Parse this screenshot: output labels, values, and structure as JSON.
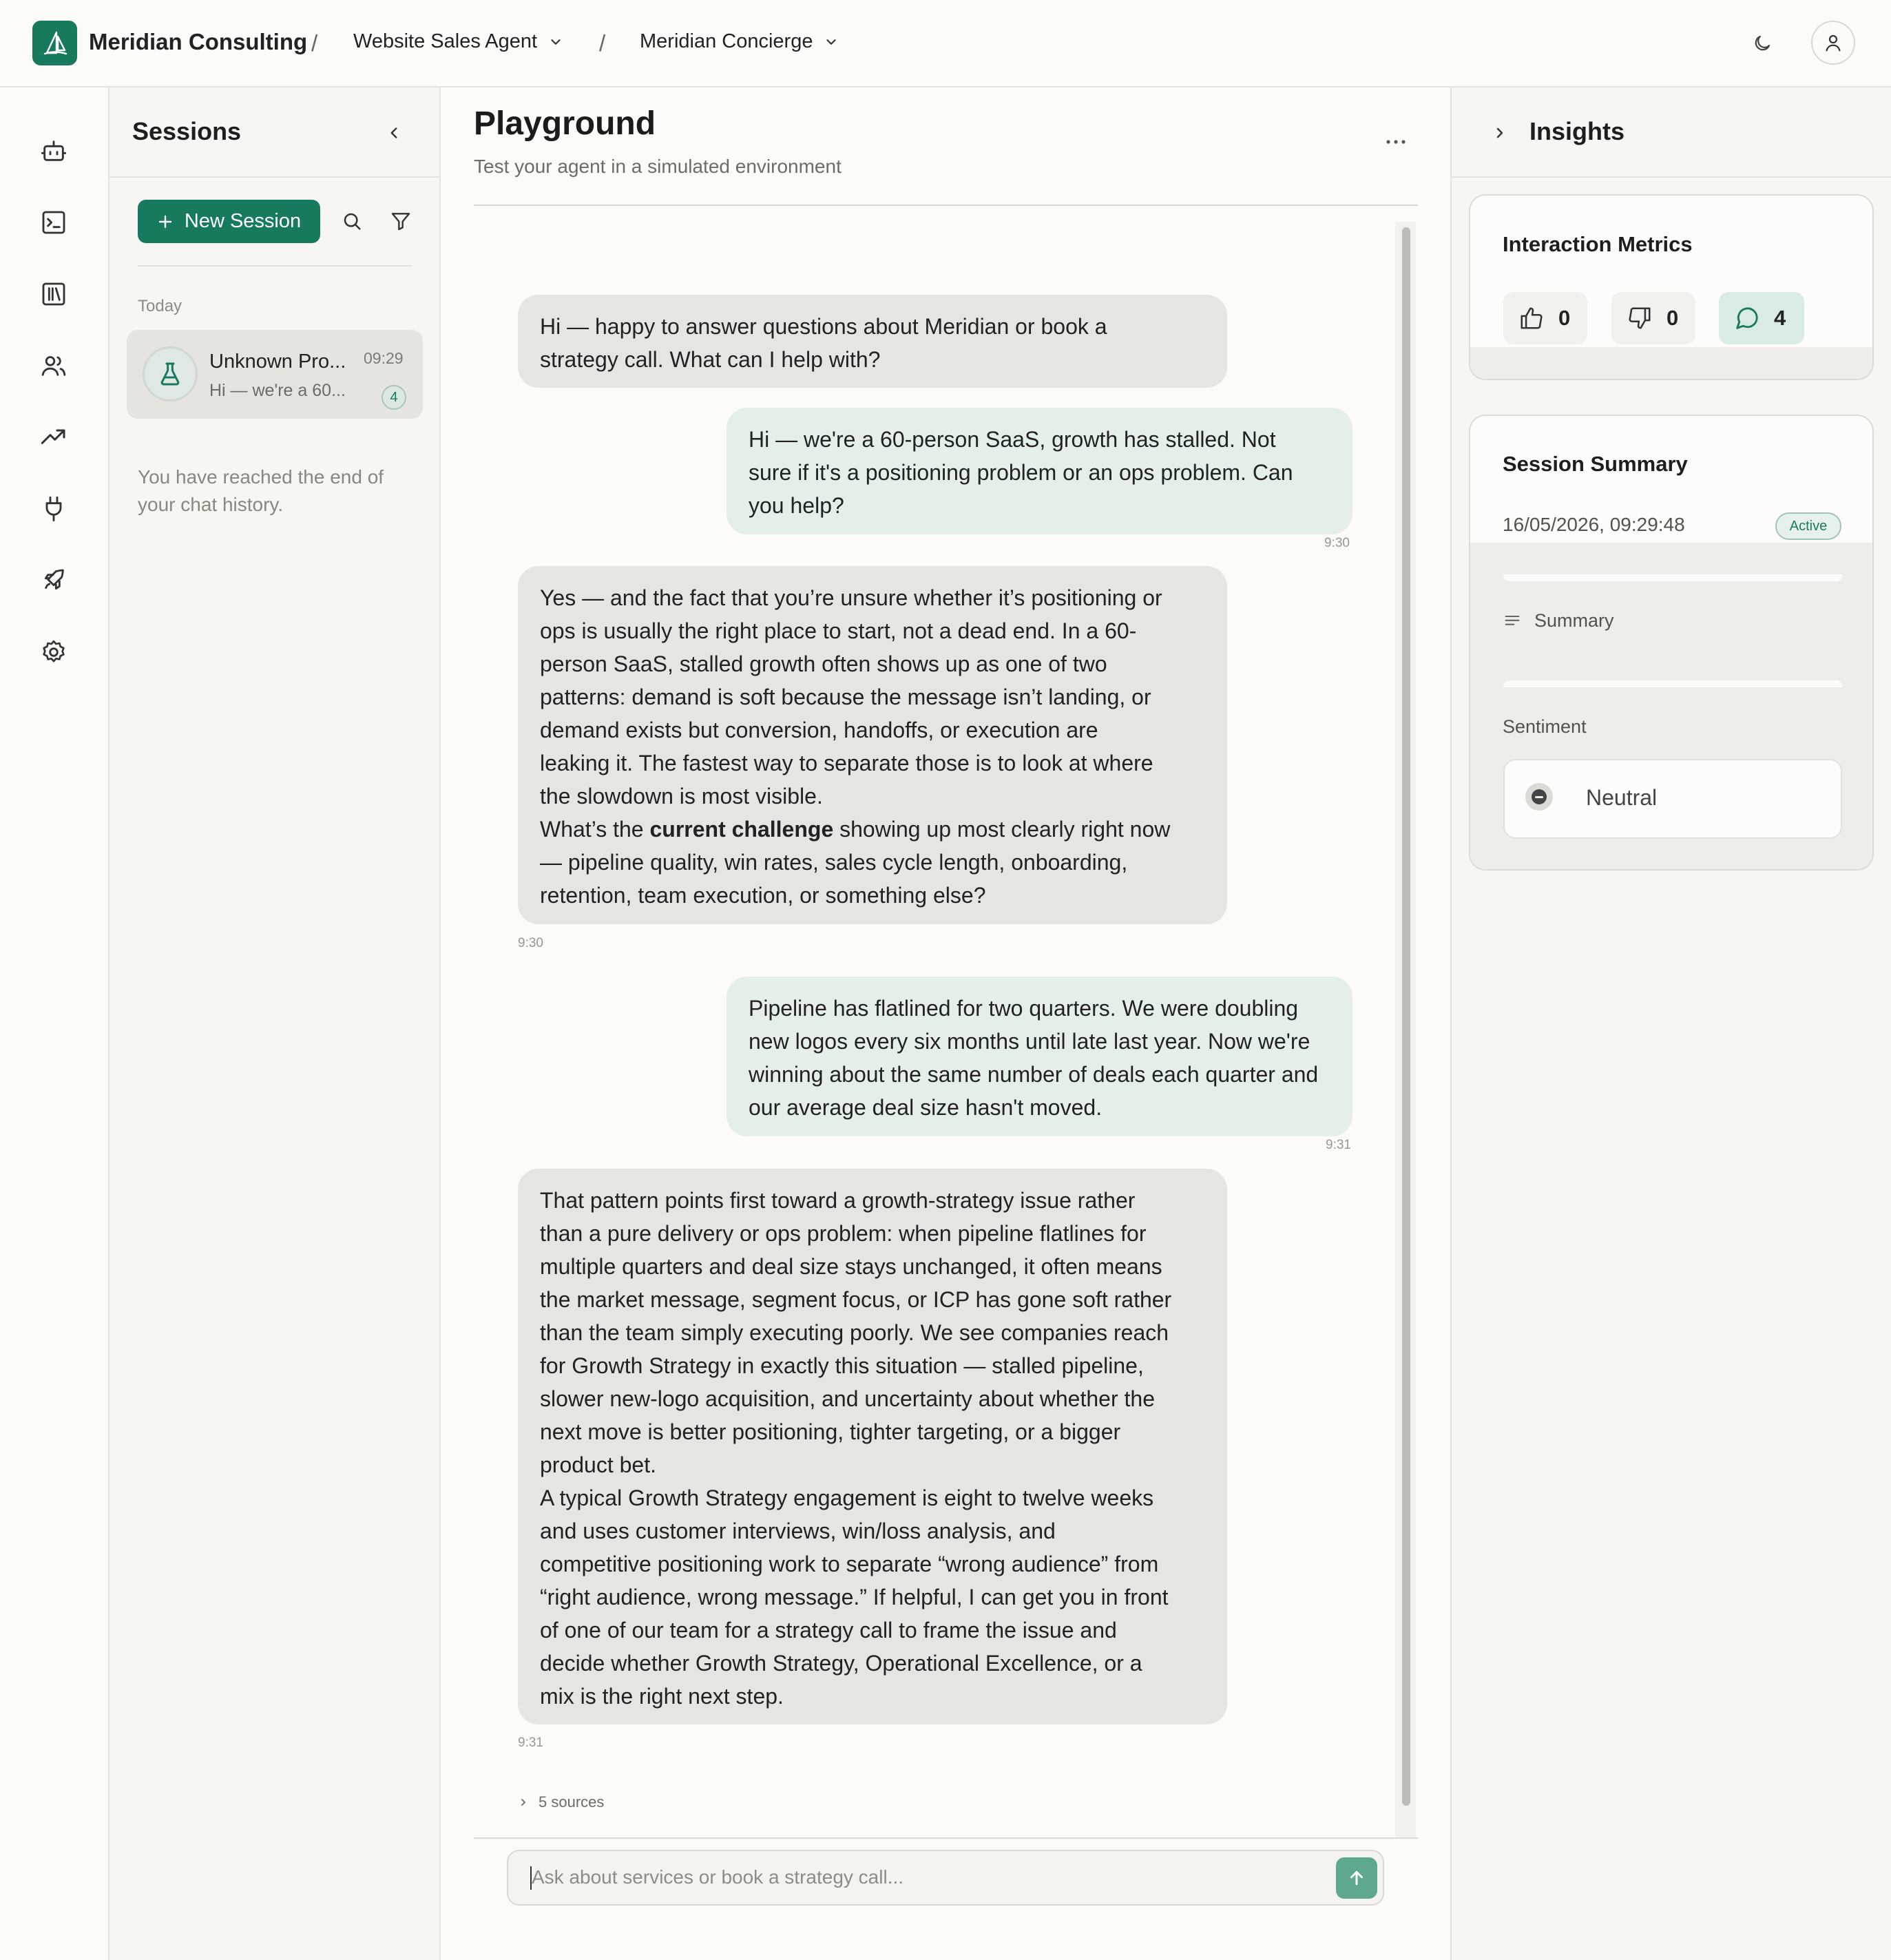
{
  "header": {
    "brand": "Meridian Consulting",
    "separator": "/",
    "crumb1": "Website Sales Agent",
    "crumb2": "Meridian Concierge"
  },
  "sessions": {
    "title": "Sessions",
    "new_session_label": "New Session",
    "group_label": "Today",
    "items": [
      {
        "title": "Unknown Pro...",
        "time": "09:29",
        "preview": "Hi — we're a 60...",
        "count": "4"
      }
    ],
    "end_note_line1": "You have reached the end of",
    "end_note_line2": "your chat history."
  },
  "playground": {
    "title": "Playground",
    "subtitle": "Test your agent in a simulated environment",
    "more_label": "...",
    "messages": [
      {
        "role": "agent",
        "lines": [
          "Hi — happy to answer questions about Meridian or book a",
          "strategy call. What can I help with?"
        ]
      },
      {
        "role": "user",
        "lines": [
          "Hi — we're a 60-person SaaS, growth has stalled. Not",
          "sure if it's a positioning problem or an ops problem. Can",
          "you help?"
        ],
        "time": "9:30"
      },
      {
        "role": "agent",
        "lines": [
          "Yes — and the fact that you’re unsure whether it’s positioning or",
          "ops is usually the right place to start, not a dead end. In a 60-",
          "person SaaS, stalled growth often shows up as one of two",
          "patterns: demand is soft because the message isn’t landing, or",
          "demand exists but conversion, handoffs, or execution are",
          "leaking it. The fastest way to separate those is to look at where",
          "the slowdown is most visible."
        ],
        "q_prefix": "What’s the ",
        "q_bold": "current challenge",
        "q_suffix": " showing up most clearly right now",
        "q_lines": [
          "— pipeline quality, win rates, sales cycle length, onboarding,",
          "retention, team execution, or something else?"
        ],
        "time": "9:30"
      },
      {
        "role": "user",
        "lines": [
          "Pipeline has flatlined for two quarters. We were doubling",
          "new logos every six months until late last year. Now we're",
          "winning about the same number of deals each quarter and",
          "our average deal size hasn't moved."
        ],
        "time": "9:31"
      },
      {
        "role": "agent",
        "lines": [
          "That pattern points first toward a growth-strategy issue rather",
          "than a pure delivery or ops problem: when pipeline flatlines for",
          "multiple quarters and deal size stays unchanged, it often means",
          "the market message, segment focus, or ICP has gone soft rather",
          "than the team simply executing poorly. We see companies reach",
          "for Growth Strategy in exactly this situation — stalled pipeline,",
          "slower new-logo acquisition, and uncertainty about whether the",
          "next move is better positioning, tighter targeting, or a bigger",
          "product bet.",
          "A typical Growth Strategy engagement is eight to twelve weeks",
          "and uses customer interviews, win/loss analysis, and",
          "competitive positioning work to separate “wrong audience” from",
          "“right audience, wrong message.” If helpful, I can get you in front",
          "of one of our team for a strategy call to frame the issue and",
          "decide whether Growth Strategy, Operational Excellence, or a",
          "mix is the right next step."
        ],
        "time": "9:31"
      }
    ],
    "sources_label": "5 sources",
    "input_placeholder": "Ask about services or book a strategy call..."
  },
  "insights": {
    "title": "Insights",
    "metrics_title": "Interaction Metrics",
    "thumbs_up": "0",
    "thumbs_down": "0",
    "messages": "4",
    "summary_card_title": "Session Summary",
    "timestamp": "16/05/2026, 09:29:48",
    "status": "Active",
    "summary_label": "Summary",
    "sentiment_label": "Sentiment",
    "sentiment_value": "Neutral"
  },
  "colors": {
    "accent": "#177a5e",
    "user_bubble": "#e4efe8",
    "agent_bubble": "#e6e5e1",
    "background": "#fcfbf8"
  },
  "icons": {
    "rail": [
      "bot-icon",
      "terminal-icon",
      "library-icon",
      "users-icon",
      "trending-up-icon",
      "plug-icon",
      "rocket-icon",
      "settings-icon"
    ]
  }
}
